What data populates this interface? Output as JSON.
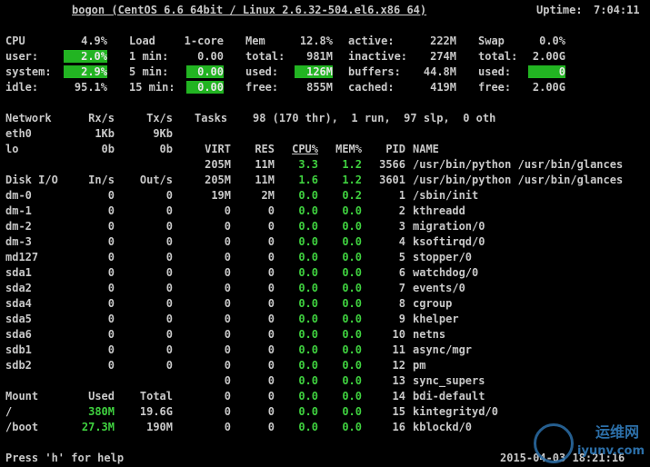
{
  "header": {
    "title": "bogon (CentOS 6.6 64bit / Linux 2.6.32-504.el6.x86 64)",
    "uptime_label": "Uptime:",
    "uptime": "7:04:11"
  },
  "cpu": {
    "label": "CPU",
    "total": "4.9%",
    "user_label": "user:",
    "user": "2.0%",
    "system_label": "system:",
    "system": "2.9%",
    "idle_label": "idle:",
    "idle": "95.1%"
  },
  "load": {
    "label": "Load",
    "cores": "1-core",
    "m1_label": "1 min:",
    "m1": "0.00",
    "m5_label": "5 min:",
    "m5": "0.00",
    "m15_label": "15 min:",
    "m15": "0.00"
  },
  "mem": {
    "label": "Mem",
    "percent": "12.8%",
    "total_label": "total:",
    "total": "981M",
    "used_label": "used:",
    "used": "126M",
    "free_label": "free:",
    "free": "855M",
    "active_label": "active:",
    "active": "222M",
    "inactive_label": "inactive:",
    "inactive": "274M",
    "buffers_label": "buffers:",
    "buffers": "44.8M",
    "cached_label": "cached:",
    "cached": "419M"
  },
  "swap": {
    "label": "Swap",
    "percent": "0.0%",
    "total_label": "total:",
    "total": "2.00G",
    "used_label": "used:",
    "used": "0",
    "free_label": "free:",
    "free": "2.00G"
  },
  "network": {
    "headers": [
      "Network",
      "Rx/s",
      "Tx/s"
    ],
    "rows": [
      {
        "name": "eth0",
        "rx": "1Kb",
        "tx": "9Kb"
      },
      {
        "name": "lo",
        "rx": "0b",
        "tx": "0b"
      }
    ]
  },
  "tasks": {
    "label": "Tasks",
    "summary": "98 (170 thr),  1 run,  97 slp,  0 oth"
  },
  "disk": {
    "headers": [
      "Disk I/O",
      "In/s",
      "Out/s"
    ],
    "rows": [
      {
        "name": "dm-0",
        "in": "0",
        "out": "0"
      },
      {
        "name": "dm-1",
        "in": "0",
        "out": "0"
      },
      {
        "name": "dm-2",
        "in": "0",
        "out": "0"
      },
      {
        "name": "dm-3",
        "in": "0",
        "out": "0"
      },
      {
        "name": "md127",
        "in": "0",
        "out": "0"
      },
      {
        "name": "sda1",
        "in": "0",
        "out": "0"
      },
      {
        "name": "sda2",
        "in": "0",
        "out": "0"
      },
      {
        "name": "sda4",
        "in": "0",
        "out": "0"
      },
      {
        "name": "sda5",
        "in": "0",
        "out": "0"
      },
      {
        "name": "sda6",
        "in": "0",
        "out": "0"
      },
      {
        "name": "sdb1",
        "in": "0",
        "out": "0"
      },
      {
        "name": "sdb2",
        "in": "0",
        "out": "0"
      }
    ]
  },
  "mount": {
    "headers": [
      "Mount",
      "Used",
      "Total"
    ],
    "rows": [
      {
        "name": "/",
        "used": "380M",
        "total": "19.6G"
      },
      {
        "name": "/boot",
        "used": "27.3M",
        "total": "190M"
      }
    ]
  },
  "processes": {
    "headers": [
      "VIRT",
      "RES",
      "CPU%",
      "MEM%",
      "PID",
      "NAME"
    ],
    "rows": [
      {
        "virt": "205M",
        "res": "11M",
        "cpu": "3.3",
        "mem": "1.2",
        "pid": "3566",
        "name": "/usr/bin/python /usr/bin/glances"
      },
      {
        "virt": "205M",
        "res": "11M",
        "cpu": "1.6",
        "mem": "1.2",
        "pid": "3601",
        "name": "/usr/bin/python /usr/bin/glances"
      },
      {
        "virt": "19M",
        "res": "2M",
        "cpu": "0.0",
        "mem": "0.2",
        "pid": "1",
        "name": "/sbin/init"
      },
      {
        "virt": "0",
        "res": "0",
        "cpu": "0.0",
        "mem": "0.0",
        "pid": "2",
        "name": "kthreadd"
      },
      {
        "virt": "0",
        "res": "0",
        "cpu": "0.0",
        "mem": "0.0",
        "pid": "3",
        "name": "migration/0"
      },
      {
        "virt": "0",
        "res": "0",
        "cpu": "0.0",
        "mem": "0.0",
        "pid": "4",
        "name": "ksoftirqd/0"
      },
      {
        "virt": "0",
        "res": "0",
        "cpu": "0.0",
        "mem": "0.0",
        "pid": "5",
        "name": "stopper/0"
      },
      {
        "virt": "0",
        "res": "0",
        "cpu": "0.0",
        "mem": "0.0",
        "pid": "6",
        "name": "watchdog/0"
      },
      {
        "virt": "0",
        "res": "0",
        "cpu": "0.0",
        "mem": "0.0",
        "pid": "7",
        "name": "events/0"
      },
      {
        "virt": "0",
        "res": "0",
        "cpu": "0.0",
        "mem": "0.0",
        "pid": "8",
        "name": "cgroup"
      },
      {
        "virt": "0",
        "res": "0",
        "cpu": "0.0",
        "mem": "0.0",
        "pid": "9",
        "name": "khelper"
      },
      {
        "virt": "0",
        "res": "0",
        "cpu": "0.0",
        "mem": "0.0",
        "pid": "10",
        "name": "netns"
      },
      {
        "virt": "0",
        "res": "0",
        "cpu": "0.0",
        "mem": "0.0",
        "pid": "11",
        "name": "async/mgr"
      },
      {
        "virt": "0",
        "res": "0",
        "cpu": "0.0",
        "mem": "0.0",
        "pid": "12",
        "name": "pm"
      },
      {
        "virt": "0",
        "res": "0",
        "cpu": "0.0",
        "mem": "0.0",
        "pid": "13",
        "name": "sync_supers"
      },
      {
        "virt": "0",
        "res": "0",
        "cpu": "0.0",
        "mem": "0.0",
        "pid": "14",
        "name": "bdi-default"
      },
      {
        "virt": "0",
        "res": "0",
        "cpu": "0.0",
        "mem": "0.0",
        "pid": "15",
        "name": "kintegrityd/0"
      },
      {
        "virt": "0",
        "res": "0",
        "cpu": "0.0",
        "mem": "0.0",
        "pid": "16",
        "name": "kblockd/0"
      }
    ]
  },
  "footer": {
    "help": "Press 'h' for help",
    "timestamp": "2015-04-03 18:21:16"
  },
  "watermark": {
    "cn": "运维网",
    "en": "iyunv.com"
  },
  "colors": {
    "background": "#000000",
    "text": "#c8c8c8",
    "ok_green": "#3fd13f",
    "highlight_green": "#22b422"
  }
}
